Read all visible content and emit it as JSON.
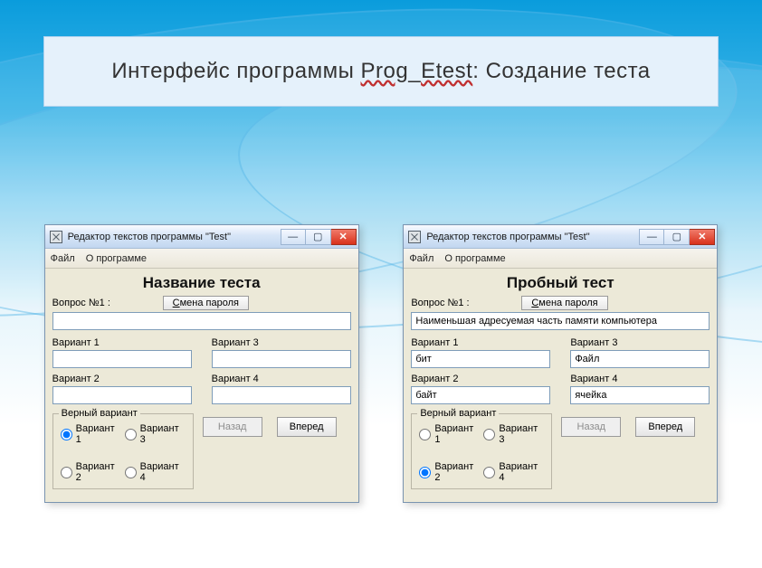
{
  "slide": {
    "title_prefix": "Интерфейс программы ",
    "title_app_part1": "Prog",
    "title_app_sep": "_",
    "title_app_part2": "Etest",
    "title_suffix": ": Создание теста"
  },
  "window_shared": {
    "title": "Редактор текстов программы \"Test\"",
    "menu_file": "Файл",
    "menu_about": "О программе",
    "change_pw_label": "Смена пароля",
    "change_pw_u": "С",
    "change_pw_rest": "мена пароля",
    "question_label": "Вопрос №1 :",
    "variant1_label": "Вариант 1",
    "variant2_label": "Вариант 2",
    "variant3_label": "Вариант 3",
    "variant4_label": "Вариант 4",
    "correctbox_legend": "Верный вариант",
    "radio1": "Вариант 1",
    "radio2": "Вариант 2",
    "radio3": "Вариант 3",
    "radio4": "Вариант 4",
    "back_label": "Назад",
    "fwd_label": "Вперед",
    "min_glyph": "—",
    "max_glyph": "▢",
    "close_glyph": "✕"
  },
  "left": {
    "test_title": "Название теста",
    "question_value": "",
    "v1": "",
    "v2": "",
    "v3": "",
    "v4": "",
    "selected_radio": 1
  },
  "right": {
    "test_title": "Пробный тест",
    "question_value": "Наименьшая адресуемая часть памяти компьютера",
    "v1": "бит",
    "v2": "байт",
    "v3": "Файл",
    "v4": "ячейка",
    "selected_radio": 2
  }
}
